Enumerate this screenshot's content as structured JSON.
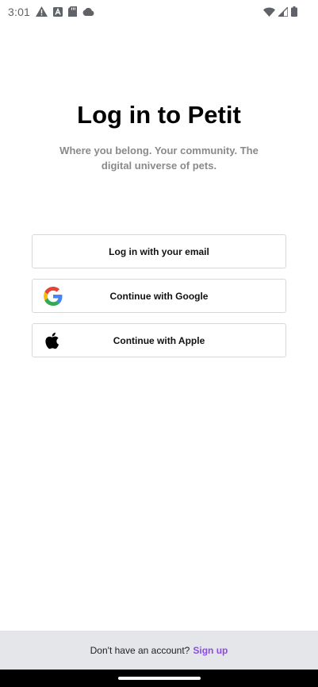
{
  "status_bar": {
    "time": "3:01",
    "left_icons": [
      "alert-icon",
      "app-notification-icon",
      "sd-card-icon",
      "cloud-icon"
    ],
    "right_icons": [
      "wifi-icon",
      "signal-icon",
      "battery-icon"
    ]
  },
  "main": {
    "title": "Log in to Petit",
    "subtitle": "Where you belong. Your community. The digital universe of pets."
  },
  "buttons": {
    "email_label": "Log in with your email",
    "google_label": "Continue with Google",
    "apple_label": "Continue with Apple"
  },
  "footer": {
    "prompt": "Don't have an account?",
    "signup_label": "Sign up"
  },
  "colors": {
    "accent": "#8a4de6",
    "subtitle": "#8a8a8a",
    "footer_bg": "#e4e6e9"
  }
}
